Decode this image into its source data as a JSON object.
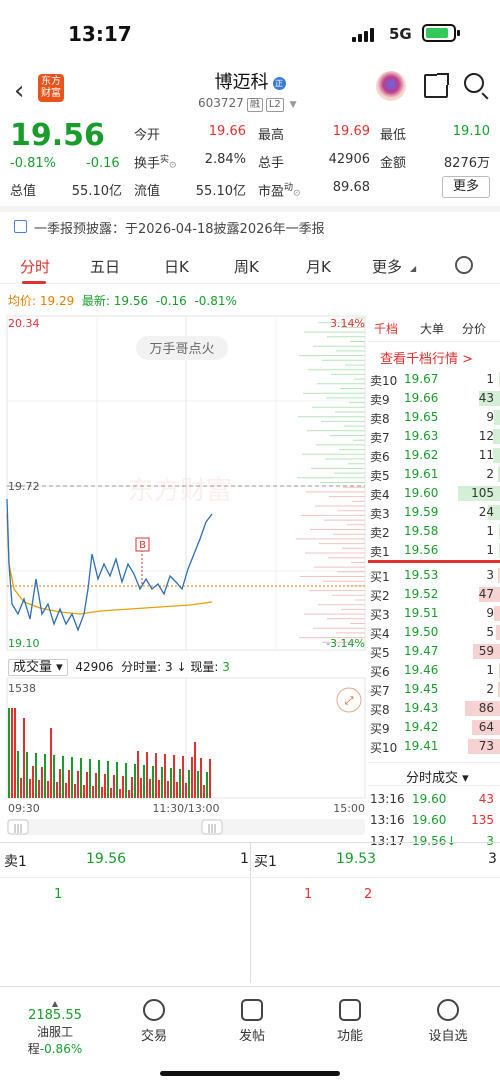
{
  "status": {
    "time": "13:17",
    "network": "5G"
  },
  "header": {
    "logo_line1": "东方",
    "logo_line2": "财富",
    "name": "博迈科",
    "name_tag": "正",
    "code": "603727",
    "badge1": "融",
    "badge2": "L2"
  },
  "quote": {
    "price": "19.56",
    "pct": "-0.81%",
    "change": "-0.16",
    "open_label": "今开",
    "open": "19.66",
    "high_label": "最高",
    "high": "19.69",
    "low_label": "最低",
    "low": "19.10",
    "turnover_label": "换手",
    "turnover_sup": "实",
    "turnover": "2.84%",
    "vol_label": "总手",
    "vol": "42906",
    "amount_label": "金额",
    "amount": "8276万",
    "mcap_label": "总值",
    "mcap": "55.10亿",
    "float_label": "流值",
    "float": "55.10亿",
    "pe_label": "市盈",
    "pe_sup": "动",
    "pe": "89.68",
    "more": "更多"
  },
  "notice": "一季报预披露：于2026-04-18披露2026年一季报",
  "tabs": [
    "分时",
    "五日",
    "日K",
    "周K",
    "月K",
    "更多"
  ],
  "chart_head": {
    "avg_label": "均价:",
    "avg": "19.29",
    "last_label": "最新:",
    "last": "19.56",
    "chg": "-0.16",
    "pct": "-0.81%"
  },
  "chart": {
    "top_price": "20.34",
    "bottom_price": "19.10",
    "top_pct": "3.14%",
    "bottom_pct": "-3.14%",
    "ref_price": "19.72",
    "watermark": "东方财富",
    "tip": "万手哥点火",
    "marker": "B",
    "time_start": "09:30",
    "time_mid": "11:30/13:00",
    "time_end": "15:00"
  },
  "volume_head": {
    "label": "成交量",
    "total": "42906",
    "per_label": "分时量:",
    "per": "3",
    "now_label": "现量:",
    "now": "3",
    "scale_top": "1538"
  },
  "order_book": {
    "tabs": [
      "千档",
      "大单",
      "分价"
    ],
    "link": "查看千档行情 >",
    "asks": [
      {
        "name": "卖10",
        "price": "19.67",
        "qty": "1",
        "bar": 0.02
      },
      {
        "name": "卖9",
        "price": "19.66",
        "qty": "43",
        "bar": 0.3
      },
      {
        "name": "卖8",
        "price": "19.65",
        "qty": "9",
        "bar": 0.08
      },
      {
        "name": "卖7",
        "price": "19.63",
        "qty": "12",
        "bar": 0.1
      },
      {
        "name": "卖6",
        "price": "19.62",
        "qty": "11",
        "bar": 0.1
      },
      {
        "name": "卖5",
        "price": "19.61",
        "qty": "2",
        "bar": 0.03
      },
      {
        "name": "卖4",
        "price": "19.60",
        "qty": "105",
        "bar": 0.6
      },
      {
        "name": "卖3",
        "price": "19.59",
        "qty": "24",
        "bar": 0.17
      },
      {
        "name": "卖2",
        "price": "19.58",
        "qty": "1",
        "bar": 0.02
      },
      {
        "name": "卖1",
        "price": "19.56",
        "qty": "1",
        "bar": 0.02
      }
    ],
    "bids": [
      {
        "name": "买1",
        "price": "19.53",
        "qty": "3",
        "bar": 0.03
      },
      {
        "name": "买2",
        "price": "19.52",
        "qty": "47",
        "bar": 0.3
      },
      {
        "name": "买3",
        "price": "19.51",
        "qty": "9",
        "bar": 0.08
      },
      {
        "name": "买4",
        "price": "19.50",
        "qty": "5",
        "bar": 0.05
      },
      {
        "name": "买5",
        "price": "19.47",
        "qty": "59",
        "bar": 0.38
      },
      {
        "name": "买6",
        "price": "19.46",
        "qty": "1",
        "bar": 0.02
      },
      {
        "name": "买7",
        "price": "19.45",
        "qty": "2",
        "bar": 0.03
      },
      {
        "name": "买8",
        "price": "19.43",
        "qty": "86",
        "bar": 0.5
      },
      {
        "name": "买9",
        "price": "19.42",
        "qty": "64",
        "bar": 0.4
      },
      {
        "name": "买10",
        "price": "19.41",
        "qty": "73",
        "bar": 0.45
      }
    ],
    "trades_title": "分时成交",
    "trades": [
      {
        "time": "13:16",
        "price": "19.60",
        "qty": "43"
      },
      {
        "time": "13:16",
        "price": "19.60",
        "qty": "135"
      },
      {
        "time": "13:17",
        "price": "19.56↓",
        "qty": "3"
      }
    ]
  },
  "bottom_pair": {
    "sell_label": "卖1",
    "sell_price": "19.56",
    "sell_count": "1",
    "sell_item": "1",
    "buy_label": "买1",
    "buy_price": "19.53",
    "buy_count": "3",
    "buy_item1": "1",
    "buy_item2": "2"
  },
  "nav": {
    "index_value": "2185.55",
    "index_name": "油服工程",
    "index_pct": "-0.86%",
    "trade": "交易",
    "post": "发帖",
    "func": "功能",
    "watchlist": "设自选"
  },
  "colors": {
    "up": "#e03131",
    "down": "#1a9c2d",
    "avg": "#e67e00",
    "line": "#2f6db5"
  }
}
